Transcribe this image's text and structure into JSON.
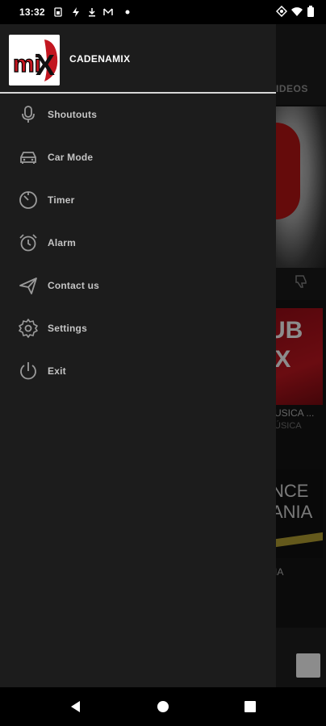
{
  "status_bar": {
    "time": "13:32",
    "notification_icons": [
      "sim-icon",
      "lightning-icon",
      "download-icon",
      "mail-icon",
      "dot-icon"
    ],
    "system_icons": [
      "vpn-key-icon",
      "wifi-icon",
      "battery-icon"
    ]
  },
  "background_app": {
    "tab_label": "IDEOS",
    "card1": {
      "art_line1": "UB",
      "art_line2": "IX",
      "title": "USICA ...",
      "subtitle": "ÚSICA"
    },
    "card2": {
      "art_line1": "NCE",
      "art_line2": "ANIA",
      "title": "IA"
    }
  },
  "drawer": {
    "title": "CADENAMIX",
    "logo_text": "miX",
    "items": [
      {
        "label": "Shoutouts",
        "icon": "microphone-icon"
      },
      {
        "label": "Car Mode",
        "icon": "car-icon"
      },
      {
        "label": "Timer",
        "icon": "timer-icon"
      },
      {
        "label": "Alarm",
        "icon": "alarm-clock-icon"
      },
      {
        "label": "Contact us",
        "icon": "send-icon"
      },
      {
        "label": "Settings",
        "icon": "gear-icon"
      },
      {
        "label": "Exit",
        "icon": "power-icon"
      }
    ]
  },
  "nav_bar": {
    "buttons": [
      "back-icon",
      "home-icon",
      "recents-icon"
    ]
  },
  "colors": {
    "drawer_bg": "#1c1c1c",
    "text": "#c4c4c4",
    "brand_red": "#c21620"
  }
}
